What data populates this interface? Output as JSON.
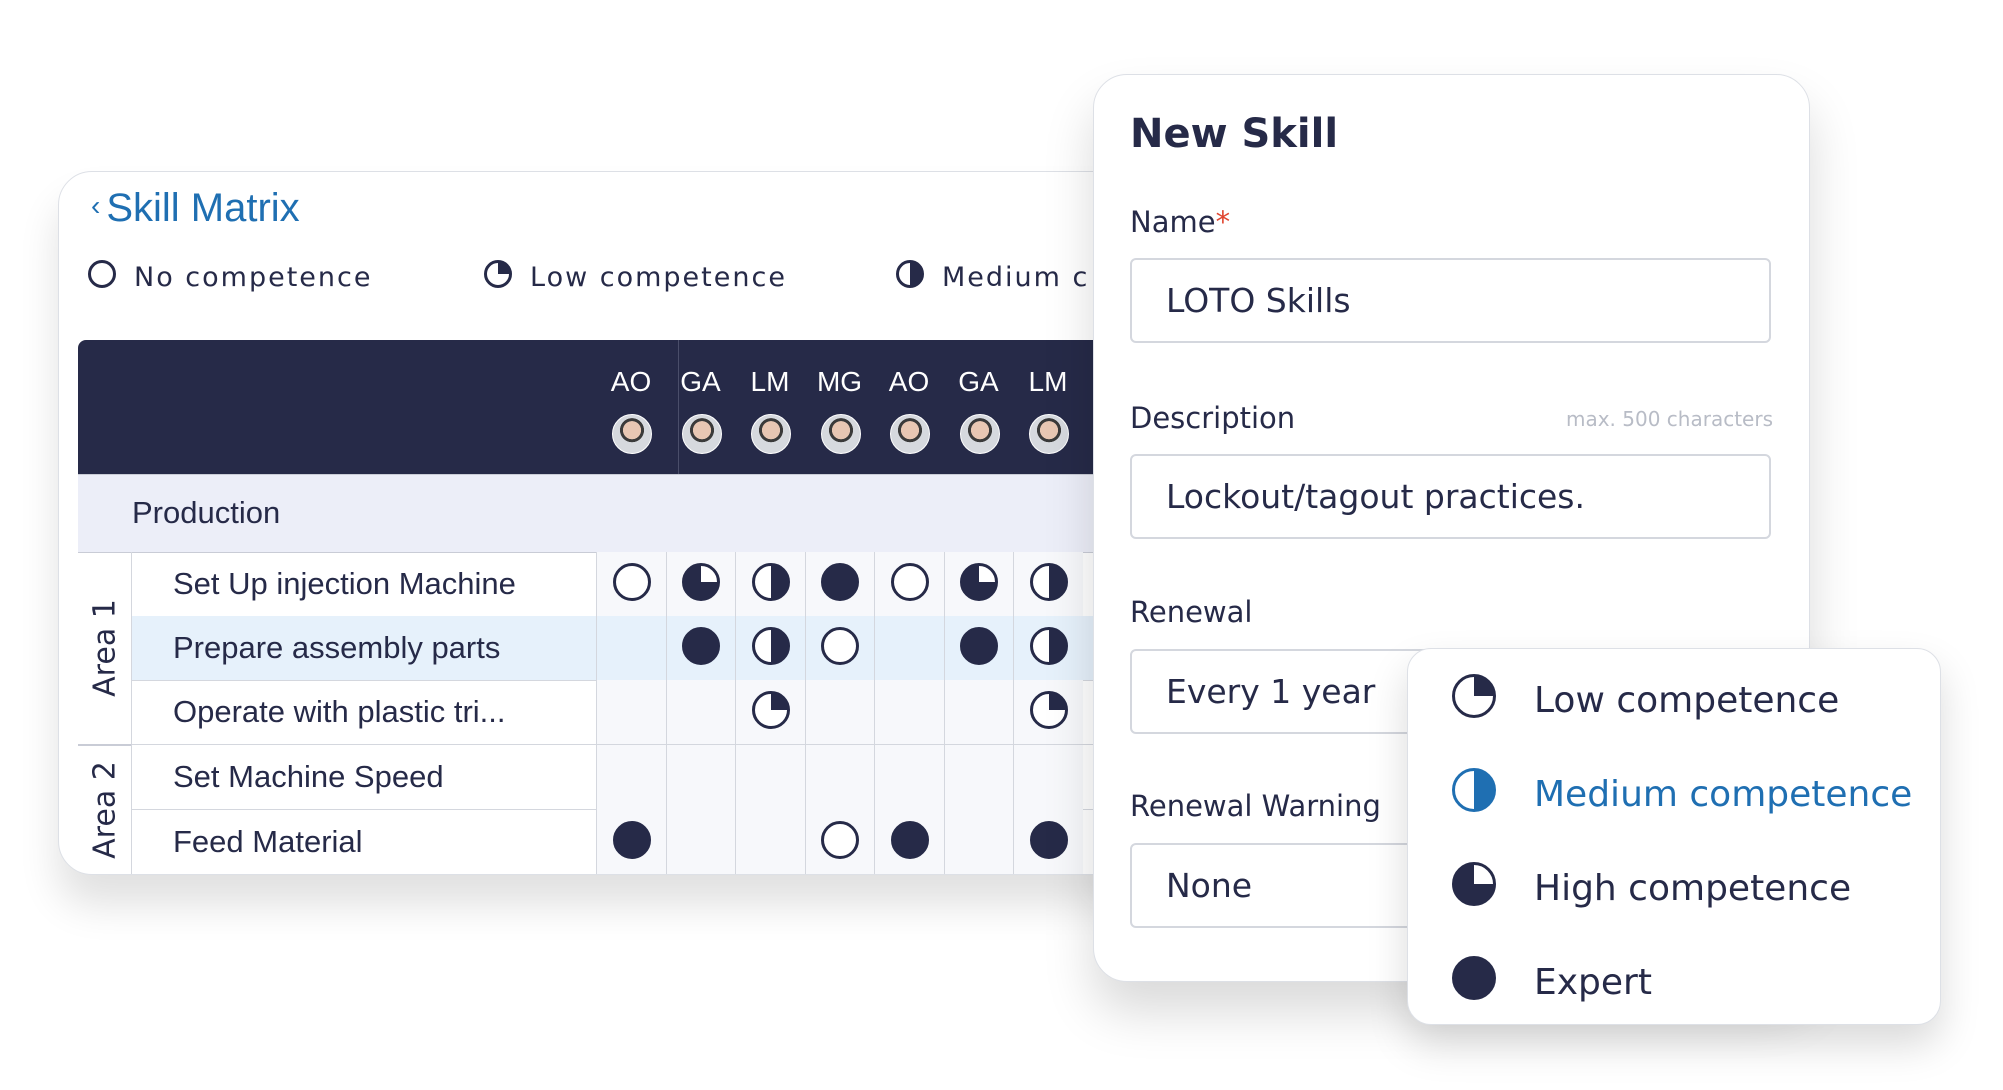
{
  "matrix": {
    "title": "Skill Matrix",
    "legend": [
      {
        "level": 0,
        "label": "No competence"
      },
      {
        "level": 1,
        "label": "Low competence"
      },
      {
        "level": 2,
        "label": "Medium c"
      }
    ],
    "columns": [
      "AO",
      "GA",
      "LM",
      "MG",
      "AO",
      "GA",
      "LM"
    ],
    "group": "Production",
    "areas": [
      {
        "label": "Area 1",
        "rows": [
          {
            "name": "Set Up injection Machine",
            "levels": [
              0,
              3,
              2,
              4,
              0,
              3,
              2
            ]
          },
          {
            "name": "Prepare assembly parts",
            "levels": [
              null,
              4,
              2,
              0,
              null,
              4,
              2
            ],
            "highlighted": true
          },
          {
            "name": "Operate with plastic tri...",
            "levels": [
              null,
              null,
              1,
              null,
              null,
              null,
              1
            ]
          }
        ]
      },
      {
        "label": "Area 2",
        "rows": [
          {
            "name": "Set Machine Speed",
            "levels": [
              null,
              null,
              null,
              null,
              null,
              null,
              null
            ]
          },
          {
            "name": "Feed Material",
            "levels": [
              4,
              null,
              null,
              0,
              4,
              null,
              4
            ]
          }
        ]
      }
    ]
  },
  "modal": {
    "title": "New Skill",
    "name_label": "Name",
    "required_mark": "*",
    "name_value": "LOTO Skills",
    "description_label": "Description",
    "description_hint": "max. 500 characters",
    "description_value": "Lockout/tagout practices.",
    "renewal_label": "Renewal",
    "renewal_value": "Every 1 year",
    "renewal_warning_label": "Renewal Warning",
    "renewal_warning_value": "None"
  },
  "dropdown": {
    "items": [
      {
        "level": 1,
        "label": "Low competence"
      },
      {
        "level": 2,
        "label": "Medium competence",
        "active": true
      },
      {
        "level": 3,
        "label": "High competence"
      },
      {
        "level": 4,
        "label": "Expert"
      }
    ]
  },
  "colors": {
    "dark": "#262a48",
    "accent": "#1f6fb2",
    "highlight": "#e6f1fb"
  }
}
